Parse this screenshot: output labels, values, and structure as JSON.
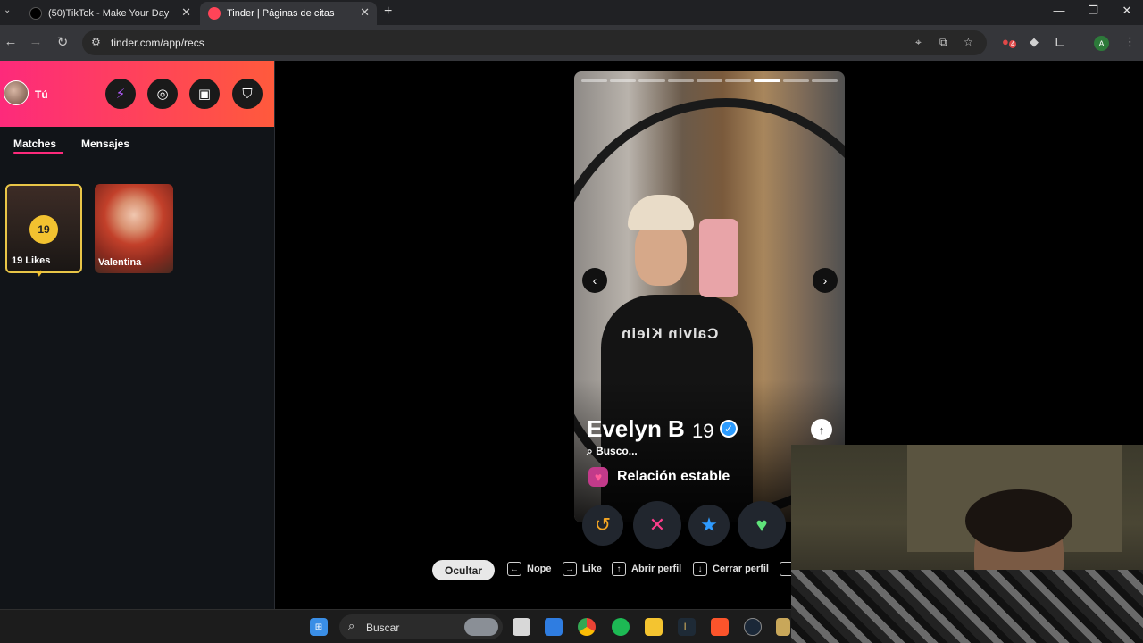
{
  "browser": {
    "tabs": [
      {
        "title": "(50)TikTok - Make Your Day",
        "active": false
      },
      {
        "title": "Tinder | Páginas de citas",
        "active": true
      }
    ],
    "new_tab_symbol": "+",
    "url": "tinder.com/app/recs",
    "profile_initial": "A",
    "extension_badge": "4"
  },
  "sidebar": {
    "user_label": "Tú",
    "header_buttons": [
      "bolt-icon",
      "explore-icon",
      "briefcase-icon",
      "shield-icon"
    ],
    "tabs": [
      "Matches",
      "Mensajes"
    ],
    "active_tab": "Matches",
    "likes_count": "19",
    "likes_label": "19 Likes",
    "match_name": "Valentina"
  },
  "profile": {
    "name": "Evelyn B",
    "age": "19",
    "verified": true,
    "looking_for_label": "Busco...",
    "relationship_goal": "Relación estable",
    "photo_count": 9,
    "current_photo_index": 7,
    "shirt_text": "Calvin Klein"
  },
  "actions": [
    {
      "name": "rewind",
      "symbol": "↺",
      "color": "#f5a623"
    },
    {
      "name": "nope",
      "symbol": "✕",
      "color": "#ff3d8b"
    },
    {
      "name": "super-like",
      "symbol": "★",
      "color": "#2f9bff"
    },
    {
      "name": "like",
      "symbol": "♥",
      "color": "#5fe37a"
    }
  ],
  "shortcuts": {
    "hide_label": "Ocultar",
    "items": [
      {
        "key": "←",
        "label": "Nope"
      },
      {
        "key": "→",
        "label": "Like"
      },
      {
        "key": "↑",
        "label": "Abrir perfil"
      },
      {
        "key": "↓",
        "label": "Cerrar perfil"
      }
    ]
  },
  "taskbar": {
    "search_placeholder": "Buscar"
  },
  "colors": {
    "brand_gradient_start": "#fd2a7b",
    "brand_gradient_end": "#ff5a3c",
    "gold": "#f2c230",
    "verified_blue": "#2d9cff"
  }
}
